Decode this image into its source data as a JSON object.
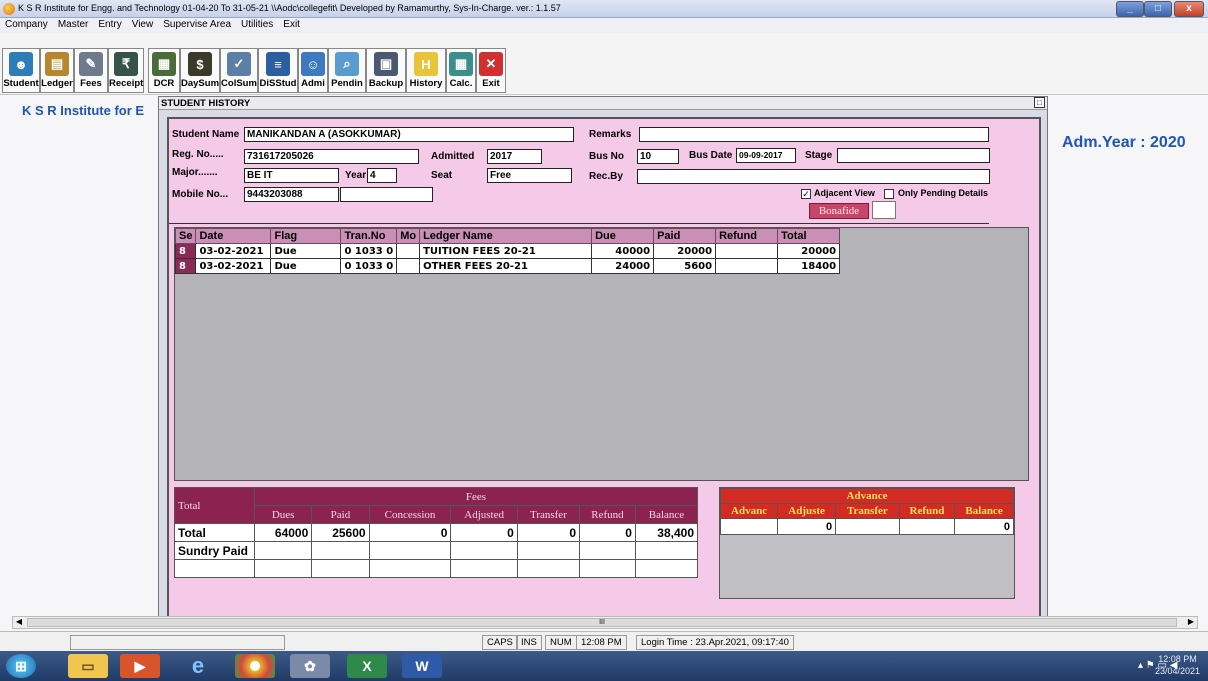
{
  "window": {
    "title": "K S R Institute for Engg. and Technology 01-04-20 To 31-05-21 \\\\Aodc\\collegefit\\ Developed by Ramamurthy, Sys-In-Charge. ver.: 1.1.57",
    "min": "_",
    "max": "□",
    "close": "x"
  },
  "menu": [
    "Company",
    "Master",
    "Entry",
    "View",
    "Supervise Area",
    "Utilities",
    "Exit"
  ],
  "toolbar": [
    {
      "label": "Student",
      "icon": "student-icon",
      "color": "#2e7db8",
      "glyph": "☻"
    },
    {
      "label": "Ledger",
      "icon": "ledger-icon",
      "color": "#b8862e",
      "glyph": "▤"
    },
    {
      "label": "Fees",
      "icon": "fees-icon",
      "color": "#6f7a8c",
      "glyph": "✎"
    },
    {
      "label": "Receipt",
      "icon": "receipt-icon",
      "color": "#37524a",
      "glyph": "₹"
    },
    {
      "label": "DCR",
      "icon": "dcr-icon",
      "color": "#4a6b3a",
      "glyph": "▦"
    },
    {
      "label": "DaySum",
      "icon": "money-bag-icon",
      "color": "#3a3a2a",
      "glyph": "$"
    },
    {
      "label": "ColSum",
      "icon": "broom-icon",
      "color": "#5c7fa8",
      "glyph": "✓"
    },
    {
      "label": "DiSStud",
      "icon": "document-icon",
      "color": "#2d5fa0",
      "glyph": "≡"
    },
    {
      "label": "Admi",
      "icon": "users-icon",
      "color": "#3d7ac0",
      "glyph": "☺"
    },
    {
      "label": "Pendin",
      "icon": "magnifier-icon",
      "color": "#5a9bd0",
      "glyph": "⌕"
    },
    {
      "label": "Backup",
      "icon": "backup-icon",
      "color": "#4b5870",
      "glyph": "▣"
    },
    {
      "label": "History",
      "icon": "history-icon",
      "color": "#e8c43a",
      "glyph": "H"
    },
    {
      "label": "Calc.",
      "icon": "calculator-icon",
      "color": "#3a8f8a",
      "glyph": "▦"
    },
    {
      "label": "Exit",
      "icon": "exit-icon",
      "color": "#d23030",
      "glyph": "✕"
    }
  ],
  "background": {
    "institute": "K S R Institute for E",
    "adm_year": "Adm.Year : 2020"
  },
  "history": {
    "title": "STUDENT HISTORY",
    "close": "□",
    "labels": {
      "student_name": "Student Name",
      "reg_no": "Reg. No.....",
      "major": "Major.......",
      "year": "Year",
      "mobile": "Mobile No...",
      "admitted": "Admitted",
      "seat": "Seat",
      "remarks": "Remarks",
      "bus_no": "Bus No",
      "bus_date": "Bus Date",
      "stage": "Stage",
      "rec_by": "Rec.By",
      "adjacent": "Adjacent View",
      "pending": "Only Pending Details",
      "bonafide": "Bonafide"
    },
    "values": {
      "student_name": "MANIKANDAN A (ASOKKUMAR)",
      "reg_no": "731617205026",
      "major": "BE IT",
      "year": "4",
      "mobile": "9443203088",
      "admitted": "2017",
      "seat": "Free",
      "remarks": "",
      "bus_no": "10",
      "bus_date": "09-09-2017",
      "stage": "",
      "rec_by": ""
    },
    "adjacent_checked": "✓",
    "pending_checked": ""
  },
  "grid": {
    "columns": [
      "Se",
      "Date",
      "Flag",
      "Tran.No",
      "Mo",
      "Ledger Name",
      "Due",
      "Paid",
      "Refund",
      "Total"
    ],
    "rows": [
      [
        "8",
        "03-02-2021",
        "Due",
        "0 1033 0",
        "",
        "TUITION FEES 20-21",
        "40000",
        "20000",
        "",
        "20000"
      ],
      [
        "8",
        "03-02-2021",
        "Due",
        "0 1033 0",
        "",
        "OTHER FEES 20-21",
        "24000",
        "5600",
        "",
        "18400"
      ]
    ]
  },
  "totals": {
    "corner": "Total",
    "group": "Fees",
    "columns": [
      "Dues",
      "Paid",
      "Concession",
      "Adjusted",
      "Transfer",
      "Refund",
      "Balance"
    ],
    "rows": [
      {
        "label": "Total",
        "values": [
          "64000",
          "25600",
          "0",
          "0",
          "0",
          "0",
          "38,400"
        ]
      },
      {
        "label": "Sundry Paid",
        "values": [
          "",
          "",
          "",
          "",
          "",
          "",
          ""
        ]
      }
    ]
  },
  "advance": {
    "group": "Advance",
    "columns": [
      "Advanc",
      "Adjuste",
      "Transfer",
      "Refund",
      "Balance"
    ],
    "values": [
      "",
      "0",
      "",
      "",
      "0"
    ]
  },
  "scroll": {
    "grip": "III"
  },
  "status": {
    "caps": "CAPS",
    "ins": "INS",
    "num": "NUM",
    "time": "12:08 PM",
    "login": "Login Time : 23.Apr.2021, 09:17:40"
  },
  "taskbar": {
    "time": "12:08 PM",
    "date": "23/04/2021"
  }
}
